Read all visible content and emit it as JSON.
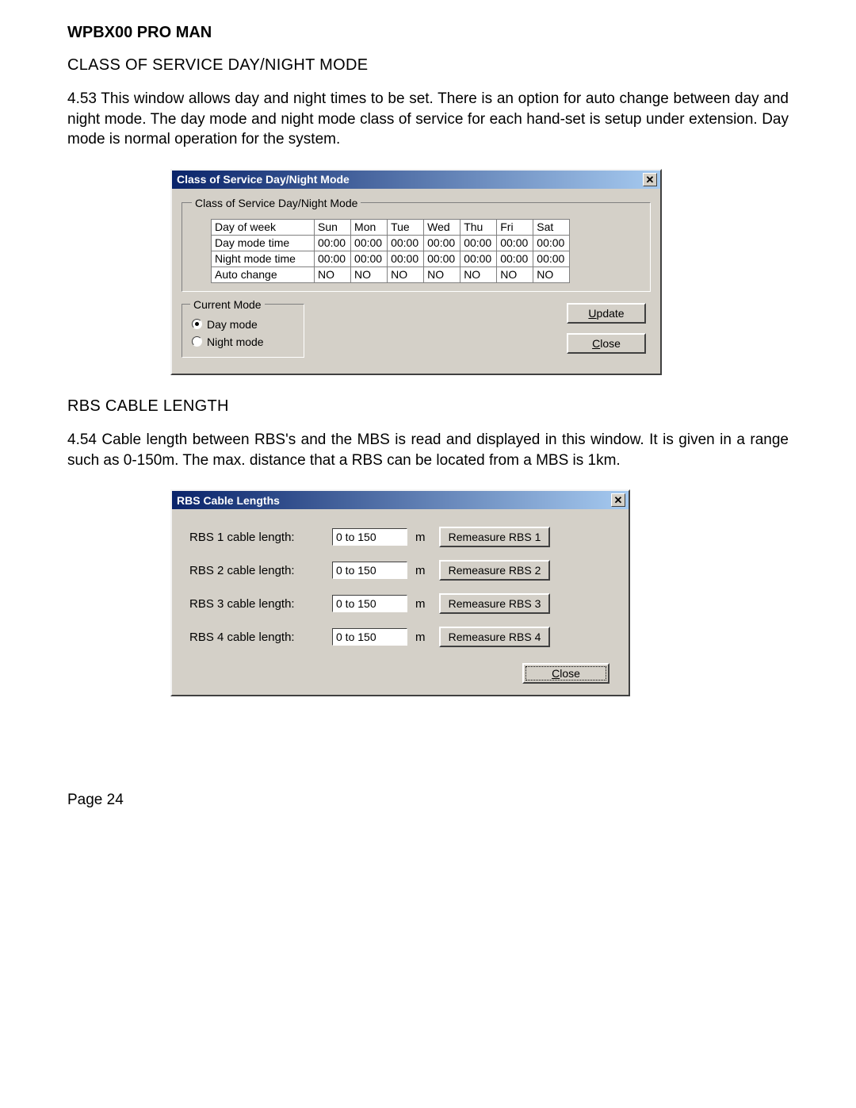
{
  "doc": {
    "title": "WPBX00 PRO MAN",
    "section1_heading": "CLASS OF SERVICE DAY/NIGHT MODE",
    "section1_body": "4.53   This window allows day and night times to be set.  There is an option for auto change between day and night mode.  The day mode and night mode class of service for each hand-set is setup under extension.  Day mode is normal operation for the system.",
    "section2_heading": "RBS CABLE LENGTH",
    "section2_body": "4.54   Cable length between RBS's and the MBS is read and displayed in this window.  It is given in a range such as 0-150m.  The max. distance that a RBS can be located  from a MBS is 1km.",
    "page": "Page 24"
  },
  "dialog1": {
    "title": "Class of Service Day/Night Mode",
    "groupbox_label": "Class of Service Day/Night Mode",
    "rows": [
      {
        "head": "Day of week",
        "cells": [
          "Sun",
          "Mon",
          "Tue",
          "Wed",
          "Thu",
          "Fri",
          "Sat"
        ]
      },
      {
        "head": "Day mode time",
        "cells": [
          "00:00",
          "00:00",
          "00:00",
          "00:00",
          "00:00",
          "00:00",
          "00:00"
        ]
      },
      {
        "head": "Night mode time",
        "cells": [
          "00:00",
          "00:00",
          "00:00",
          "00:00",
          "00:00",
          "00:00",
          "00:00"
        ]
      },
      {
        "head": "Auto change",
        "cells": [
          "NO",
          "NO",
          "NO",
          "NO",
          "NO",
          "NO",
          "NO"
        ]
      }
    ],
    "current_mode_label": "Current Mode",
    "radio_day": "Day mode",
    "radio_night": "Night mode",
    "update_btn_pre": "",
    "update_btn_u": "U",
    "update_btn_post": "pdate",
    "close_btn_u": "C",
    "close_btn_post": "lose"
  },
  "dialog2": {
    "title": "RBS Cable Lengths",
    "rows": [
      {
        "label": "RBS 1 cable length:",
        "value": "0 to 150",
        "unit": "m",
        "btn": "Remeasure RBS 1"
      },
      {
        "label": "RBS 2 cable length:",
        "value": "0 to 150",
        "unit": "m",
        "btn": "Remeasure RBS 2"
      },
      {
        "label": "RBS 3 cable length:",
        "value": "0 to 150",
        "unit": "m",
        "btn": "Remeasure RBS 3"
      },
      {
        "label": "RBS 4 cable length:",
        "value": "0 to 150",
        "unit": "m",
        "btn": "Remeasure RBS 4"
      }
    ],
    "close_btn_u": "C",
    "close_btn_post": "lose"
  }
}
